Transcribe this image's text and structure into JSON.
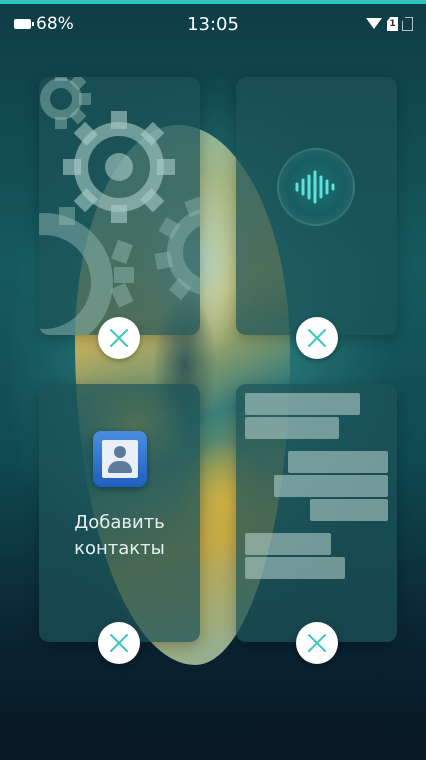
{
  "status_bar": {
    "battery_percent": "68%",
    "time": "13:05",
    "sim_slot_label": "1",
    "icons": [
      "battery-icon",
      "wifi-icon",
      "sim-1-icon",
      "sim-2-icon"
    ]
  },
  "recent_apps": [
    {
      "id": "settings",
      "icon": "gears-icon",
      "has_close": true
    },
    {
      "id": "voice-recorder",
      "icon": "sound-wave-icon",
      "has_close": true
    },
    {
      "id": "contacts",
      "icon": "contacts-icon",
      "label": "Добавить контакты",
      "label_line1": "Добавить",
      "label_line2": "контакты",
      "has_close": true
    },
    {
      "id": "messages",
      "icon": "chat-bubbles-icon",
      "has_close": true
    }
  ],
  "close_icon": "close-x-icon",
  "colors": {
    "accent": "#2ec4c0",
    "card_bg": "#1c5258",
    "voice_wave": "#5fe0d8",
    "contacts_blue": "#2f6fd0"
  }
}
